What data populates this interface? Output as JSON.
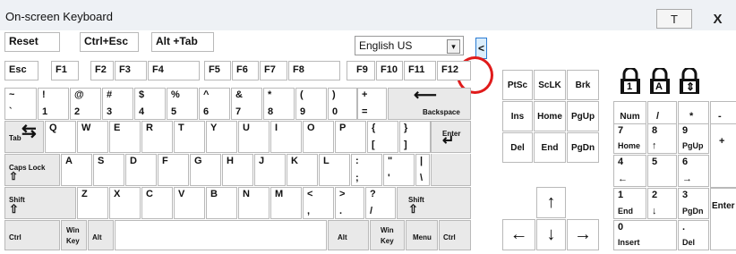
{
  "window": {
    "title": "On-screen Keyboard",
    "btn_pin": "T",
    "btn_close": "X"
  },
  "controls": {
    "reset": "Reset",
    "ctrl_esc": "Ctrl+Esc",
    "alt_tab": "Alt +Tab",
    "language": "English US",
    "dropdown_arrow": "▾",
    "collapse": "<"
  },
  "fn_row": [
    "Esc",
    "F1",
    "F2",
    "F3",
    "F4",
    "F5",
    "F6",
    "F7",
    "F8",
    "F9",
    "F10",
    "F11",
    "F12"
  ],
  "nav_keys": {
    "row1": [
      "PtSc",
      "ScLK",
      "Brk"
    ],
    "row2": [
      "Ins",
      "Home",
      "PgUp"
    ],
    "row3": [
      "Del",
      "End",
      "PgDn"
    ],
    "arrows": {
      "up": "↑",
      "left": "←",
      "down": "↓",
      "right": "→"
    }
  },
  "numpad": {
    "num": "Num",
    "div": "/",
    "mul": "*",
    "sub": "-",
    "add": "+",
    "enter": "Enter",
    "n7": [
      "7",
      "Home"
    ],
    "n8": [
      "8",
      "↑"
    ],
    "n9": [
      "9",
      "PgUp"
    ],
    "n4": [
      "4",
      "←"
    ],
    "n5": [
      "5",
      ""
    ],
    "n6": [
      "6",
      "→"
    ],
    "n1": [
      "1",
      "End"
    ],
    "n2": [
      "2",
      "↓"
    ],
    "n3": [
      "3",
      "PgDn"
    ],
    "n0": [
      "0",
      "Insert"
    ],
    "dot": [
      ".",
      "Del"
    ]
  },
  "lock_icons": [
    "1",
    "A",
    "⇕"
  ],
  "row1": [
    [
      "~",
      "`"
    ],
    [
      "!",
      "1"
    ],
    [
      "@",
      "2"
    ],
    [
      "#",
      "3"
    ],
    [
      "$",
      "4"
    ],
    [
      "%",
      "5"
    ],
    [
      "^",
      "6"
    ],
    [
      "&",
      "7"
    ],
    [
      "*",
      "8"
    ],
    [
      "(",
      "9"
    ],
    [
      ")",
      "0"
    ],
    [
      "_",
      "-"
    ],
    [
      "+",
      "="
    ]
  ],
  "backspace": {
    "arrow": "⟵",
    "label": "Backspace"
  },
  "tab": {
    "label": "Tab",
    "arrow": "⇆"
  },
  "row2": [
    "Q",
    "W",
    "E",
    "R",
    "T",
    "Y",
    "U",
    "I",
    "O",
    "P",
    [
      "{",
      "["
    ],
    [
      "}",
      "]"
    ]
  ],
  "enter": {
    "label": "Enter",
    "arrow": "↵"
  },
  "caps": {
    "label": "Caps Lock",
    "arrow": "⇧"
  },
  "row3": [
    "A",
    "S",
    "D",
    "F",
    "G",
    "H",
    "J",
    "K",
    "L",
    [
      ":",
      ";"
    ],
    [
      "\"",
      "'"
    ],
    [
      "|",
      "\\"
    ]
  ],
  "shift_left": {
    "label": "Shift",
    "arrow": "⇧"
  },
  "row4": [
    "Z",
    "X",
    "C",
    "V",
    "B",
    "N",
    "M",
    [
      "<",
      ","
    ],
    [
      ">",
      "."
    ],
    [
      "?",
      "/"
    ]
  ],
  "shift_right": {
    "label": "Shift",
    "arrow": "⇧"
  },
  "bottom": {
    "ctrl_l": "Ctrl",
    "win_l": [
      "Win",
      "Key"
    ],
    "alt_l": "Alt",
    "alt_r": "Alt",
    "win_r": [
      "Win",
      "Key"
    ],
    "menu": "Menu",
    "ctrl_r": "Ctrl"
  }
}
